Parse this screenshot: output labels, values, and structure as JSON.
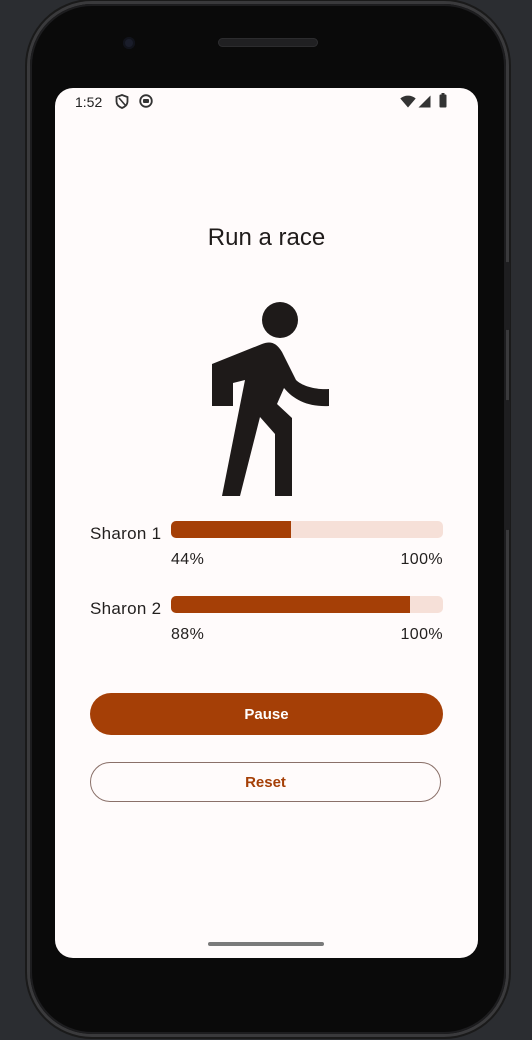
{
  "status_bar": {
    "time": "1:52",
    "left_icons": [
      "shield-icon",
      "android-notification-icon"
    ],
    "right_icons": [
      "wifi-icon",
      "cellular-signal-icon",
      "battery-icon"
    ]
  },
  "app": {
    "title": "Run a race",
    "illustration": "walking-person-icon"
  },
  "racers": [
    {
      "name": "Sharon 1",
      "progress": 0.44,
      "progress_label": "44%",
      "max_label": "100%"
    },
    {
      "name": "Sharon 2",
      "progress": 0.88,
      "progress_label": "88%",
      "max_label": "100%"
    }
  ],
  "buttons": {
    "primary_label": "Pause",
    "secondary_label": "Reset"
  },
  "colors": {
    "accent": "#a53f06",
    "track": "#f6e0d8",
    "background": "#fffbfb"
  }
}
